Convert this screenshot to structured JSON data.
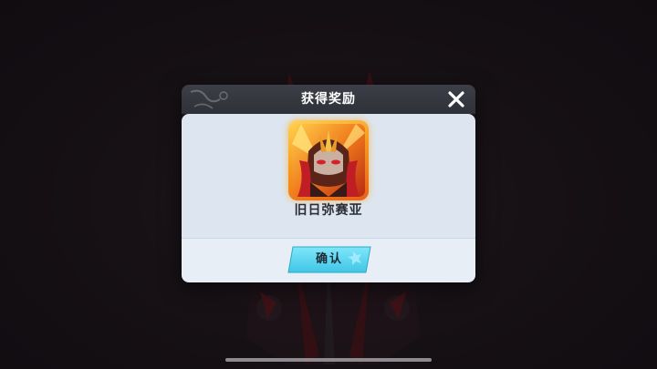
{
  "dialog": {
    "title": "获得奖励",
    "confirm_label": "确认"
  },
  "reward": {
    "name": "旧日弥赛亚",
    "frame_color": "#f59a1e"
  },
  "icons": {
    "close": "close-icon",
    "confirm_star": "star-icon"
  },
  "colors": {
    "header": "#2f3139",
    "body": "#dde6f0",
    "footer": "#e8eef5",
    "confirm_button": "#5fd8f0",
    "background": "#1d161b"
  }
}
